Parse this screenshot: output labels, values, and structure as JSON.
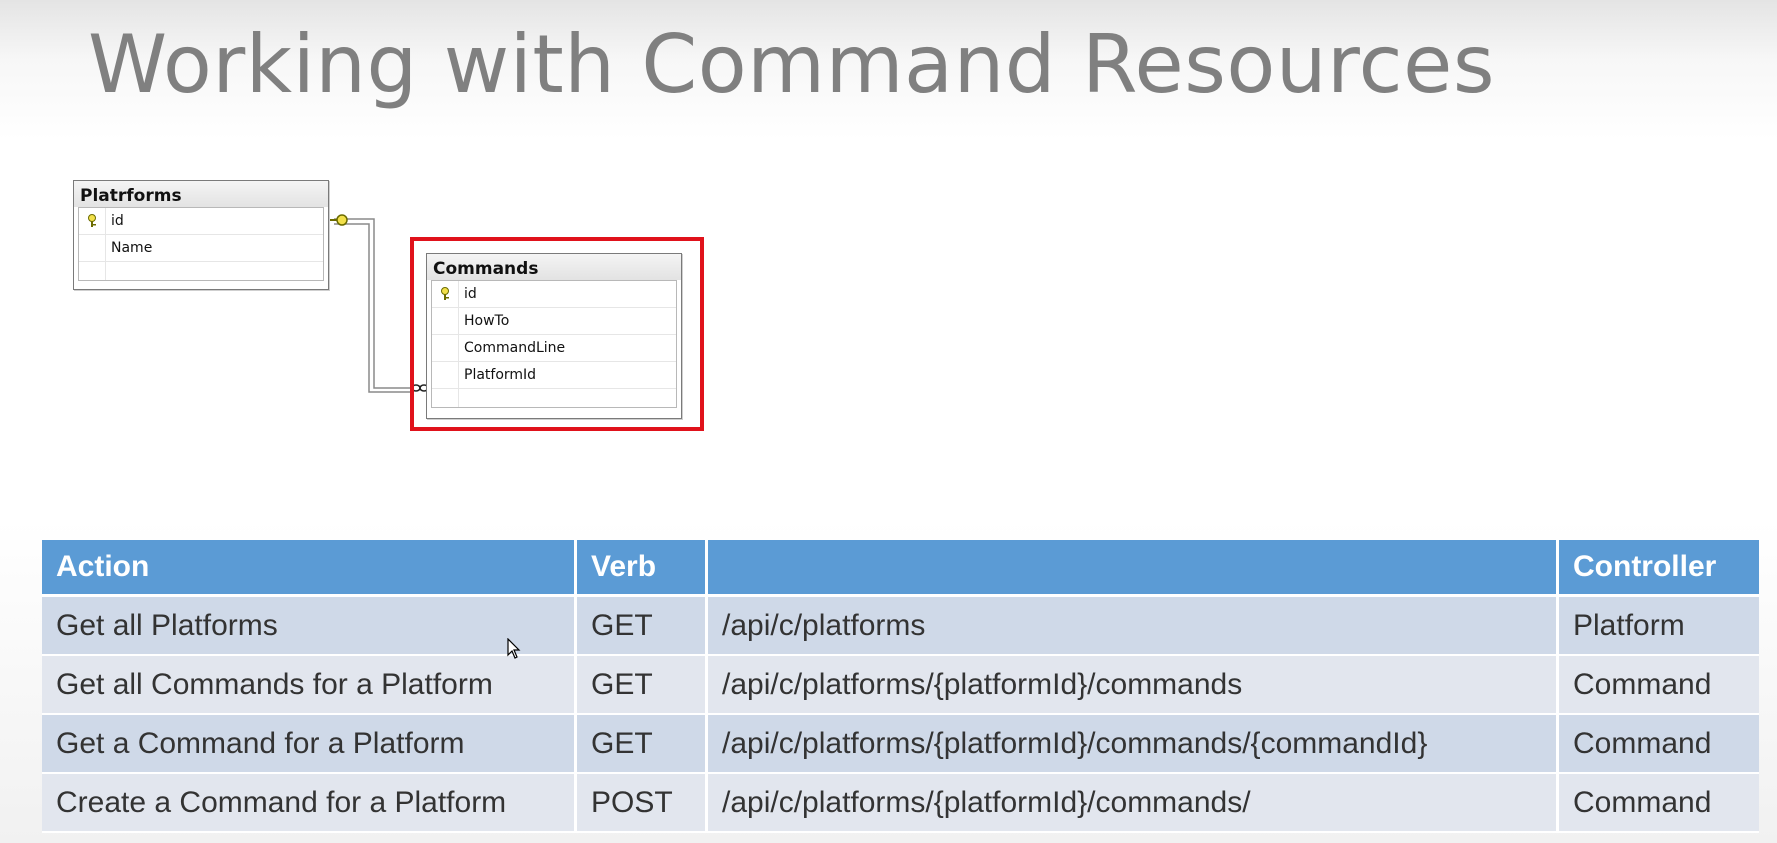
{
  "slide": {
    "title": "Working with Command Resources"
  },
  "diagram": {
    "platforms_table": {
      "name": "Platrforms",
      "columns": [
        "id",
        "Name"
      ],
      "primary_key": "id"
    },
    "commands_table": {
      "name": "Commands",
      "columns": [
        "id",
        "HowTo",
        "CommandLine",
        "PlatformId"
      ],
      "primary_key": "id",
      "highlighted": true,
      "highlight_color": "#e0121b"
    },
    "relationship": {
      "from": "Platrforms.id",
      "to": "Commands.PlatformId",
      "from_end": "key-icon",
      "to_end": "infinity-icon"
    }
  },
  "api_table": {
    "headers": [
      "Action",
      "Verb",
      "",
      "Controller"
    ],
    "header_color": "#5b9bd5",
    "rows": [
      [
        "Get all Platforms",
        "GET",
        "/api/c/platforms",
        "Platform"
      ],
      [
        "Get all Commands for a Platform",
        "GET",
        "/api/c/platforms/{platformId}/commands",
        "Command"
      ],
      [
        "Get a Command for a Platform",
        "GET",
        "/api/c/platforms/{platformId}/commands/{commandId}",
        "Command"
      ],
      [
        "Create a Command for a Platform",
        "POST",
        "/api/c/platforms/{platformId}/commands/",
        "Command"
      ]
    ]
  }
}
